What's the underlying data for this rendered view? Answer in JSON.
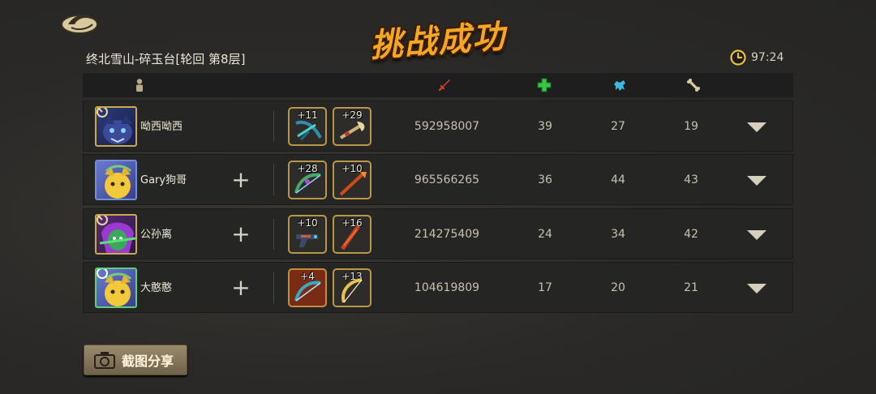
{
  "header": {
    "title": "挑战成功",
    "stage": "终北雪山-碎玉台[轮回 第8层]",
    "timer": "97:24"
  },
  "columns": [
    {
      "icon": "player-icon"
    },
    {
      "icon": "damage-sword-icon"
    },
    {
      "icon": "healing-cross-icon"
    },
    {
      "icon": "beast-icon"
    },
    {
      "icon": "bone-icon"
    }
  ],
  "players": [
    {
      "name": "呦西呦西",
      "avatar": "blue-beast-avatar",
      "show_add": false,
      "items": [
        {
          "level": "+11"
        },
        {
          "level": "+29"
        }
      ],
      "damage": "592958007",
      "stat1": "39",
      "stat2": "27",
      "stat3": "19"
    },
    {
      "name": "Gary狗哥",
      "avatar": "yellow-dog-avatar",
      "show_add": true,
      "items": [
        {
          "level": "+28"
        },
        {
          "level": "+10"
        }
      ],
      "damage": "965566265",
      "stat1": "36",
      "stat2": "44",
      "stat3": "43"
    },
    {
      "name": "公孙离",
      "avatar": "purple-hair-avatar",
      "show_add": true,
      "items": [
        {
          "level": "+10"
        },
        {
          "level": "+16"
        }
      ],
      "damage": "214275409",
      "stat1": "24",
      "stat2": "34",
      "stat3": "42"
    },
    {
      "name": "大憨憨",
      "avatar": "yellow-dog-avatar",
      "show_add": true,
      "items": [
        {
          "level": "+4"
        },
        {
          "level": "+13"
        }
      ],
      "damage": "104619809",
      "stat1": "17",
      "stat2": "20",
      "stat3": "21"
    }
  ],
  "share_button": {
    "label": "截图分享",
    "icon": "camera-icon"
  },
  "colors": {
    "accent": "#f5a623",
    "item_border": "#b9974a",
    "background": "#2b2a28"
  }
}
